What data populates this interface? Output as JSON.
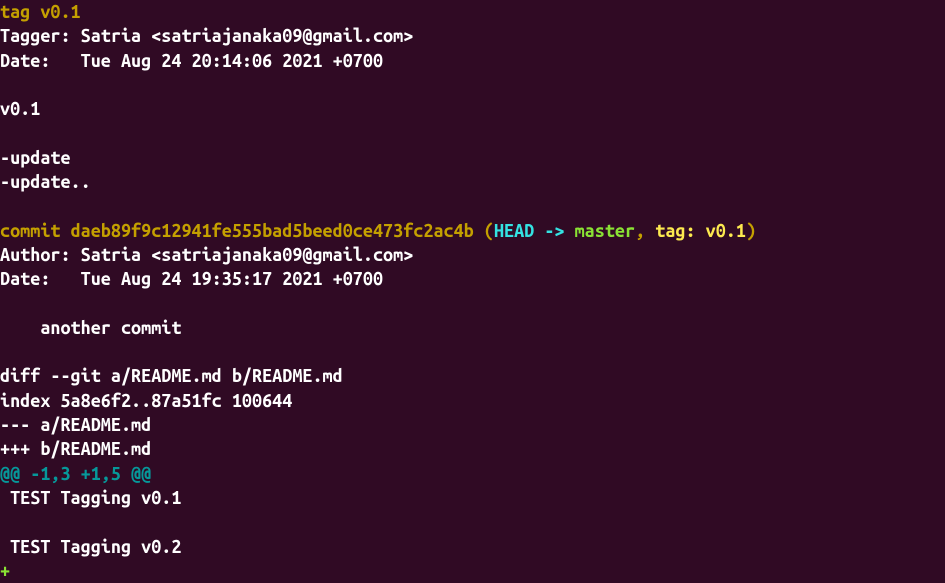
{
  "tag_header": {
    "tag_line": "tag v0.1",
    "tagger_label": "Tagger: ",
    "tagger_value": "Satria <satriajanaka09@gmail.com>",
    "date_label": "Date:   ",
    "date_value": "Tue Aug 24 20:14:06 2021 +0700"
  },
  "tag_message": {
    "version": "v0.1",
    "line1": "-update",
    "line2": "-update.."
  },
  "commit": {
    "prefix": "commit ",
    "hash": "daeb89f9c12941fe555bad5beed0ce473fc2ac4b",
    "paren_open": " (",
    "head": "HEAD -> ",
    "branch": "master",
    "comma": ", ",
    "tag_ref": "tag: v0.1",
    "paren_close": ")",
    "author_label": "Author: ",
    "author_value": "Satria <satriajanaka09@gmail.com>",
    "date_label": "Date:   ",
    "date_value": "Tue Aug 24 19:35:17 2021 +0700",
    "message": "    another commit"
  },
  "diff": {
    "diff_line": "diff --git a/README.md b/README.md",
    "index_line": "index 5a8e6f2..87a51fc 100644",
    "minus_file": "--- a/README.md",
    "plus_file": "+++ b/README.md",
    "hunk": "@@ -1,3 +1,5 @@",
    "context1": " TEST Tagging v0.1",
    "context2": " TEST Tagging v0.2",
    "plus_empty": "+"
  }
}
